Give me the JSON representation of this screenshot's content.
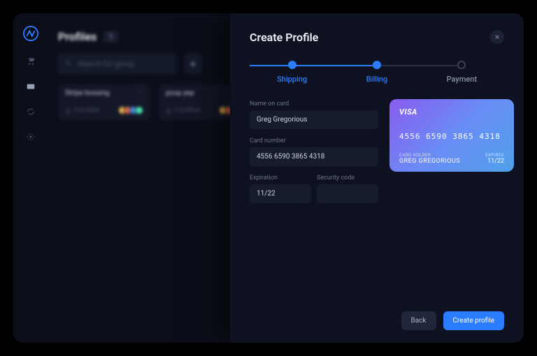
{
  "page": {
    "title": "Profiles",
    "count": "1",
    "search_placeholder": "Search for group"
  },
  "groups": [
    {
      "name": "Stripe bossing",
      "count_label": "4 profiles"
    },
    {
      "name": "poop yep",
      "count_label": "3 profiles"
    }
  ],
  "modal": {
    "title": "Create Profile",
    "steps": {
      "shipping": "Shipping",
      "billing": "Billing",
      "payment": "Payment"
    },
    "form": {
      "name_label": "Name on card",
      "name_value": "Greg Gregorious",
      "number_label": "Card number",
      "number_value": "4556 6590 3865 4318",
      "exp_label": "Expiration",
      "exp_value": "11/22",
      "cvc_label": "Security code",
      "cvc_value": ""
    },
    "card": {
      "brand": "VISA",
      "number_display": "4556  6590  3865  4318",
      "holder_label": "CARD HOLDER",
      "holder_name": "GREG GREGORIOUS",
      "exp_label": "EXPIRES",
      "exp_value": "11/22"
    },
    "footer": {
      "back": "Back",
      "create": "Create profile"
    }
  }
}
